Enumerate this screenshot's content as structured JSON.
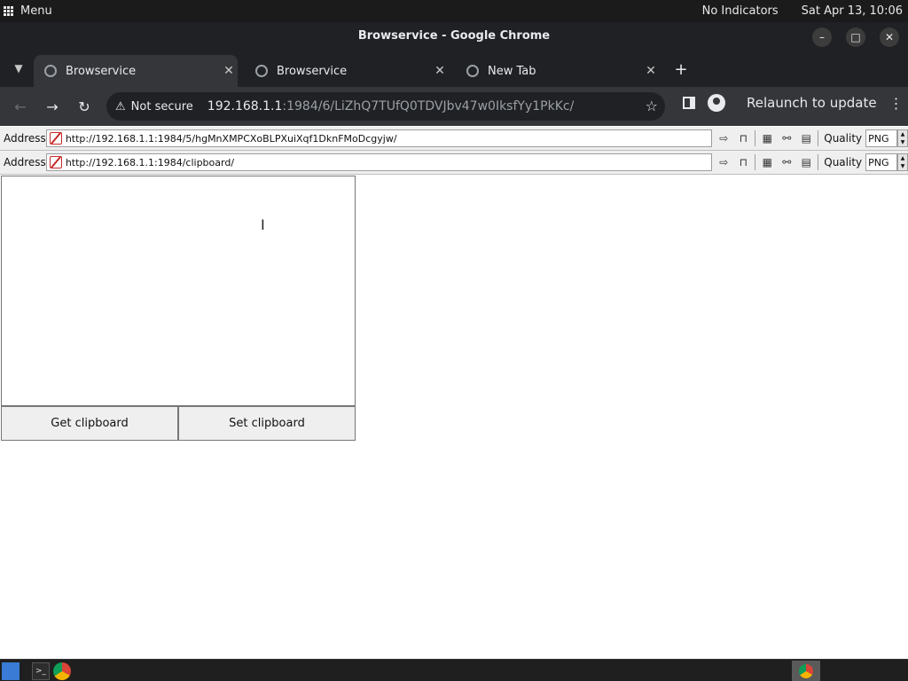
{
  "system_bar": {
    "menu_label": "Menu",
    "indicators": "No Indicators",
    "clock": "Sat Apr 13, 10:06"
  },
  "window": {
    "title": "Browservice - Google Chrome"
  },
  "tabs": [
    {
      "label": "Browservice",
      "active": true
    },
    {
      "label": "Browservice",
      "active": false
    },
    {
      "label": "New Tab",
      "active": false
    }
  ],
  "omnibox": {
    "security_label": "Not secure",
    "host": "192.168.1.1",
    "path": ":1984/6/LiZhQ7TUfQ0TDVJbv47w0IksfYy1PkKc/"
  },
  "toolbar": {
    "relaunch_label": "Relaunch to update"
  },
  "address_bars": [
    {
      "label": "Address",
      "url": "http://192.168.1.1:1984/5/hgMnXMPCXoBLPXuiXqf1DknFMoDcgyjw/",
      "quality_label": "Quality",
      "quality_value": "PNG"
    },
    {
      "label": "Address",
      "url": "http://192.168.1.1:1984/clipboard/",
      "quality_label": "Quality",
      "quality_value": "PNG"
    }
  ],
  "clipboard": {
    "text": "",
    "get_label": "Get clipboard",
    "set_label": "Set clipboard"
  },
  "colors": {
    "chrome_dark": "#202124",
    "chrome_toolbar": "#35363a",
    "page_bg": "#ffffff"
  }
}
